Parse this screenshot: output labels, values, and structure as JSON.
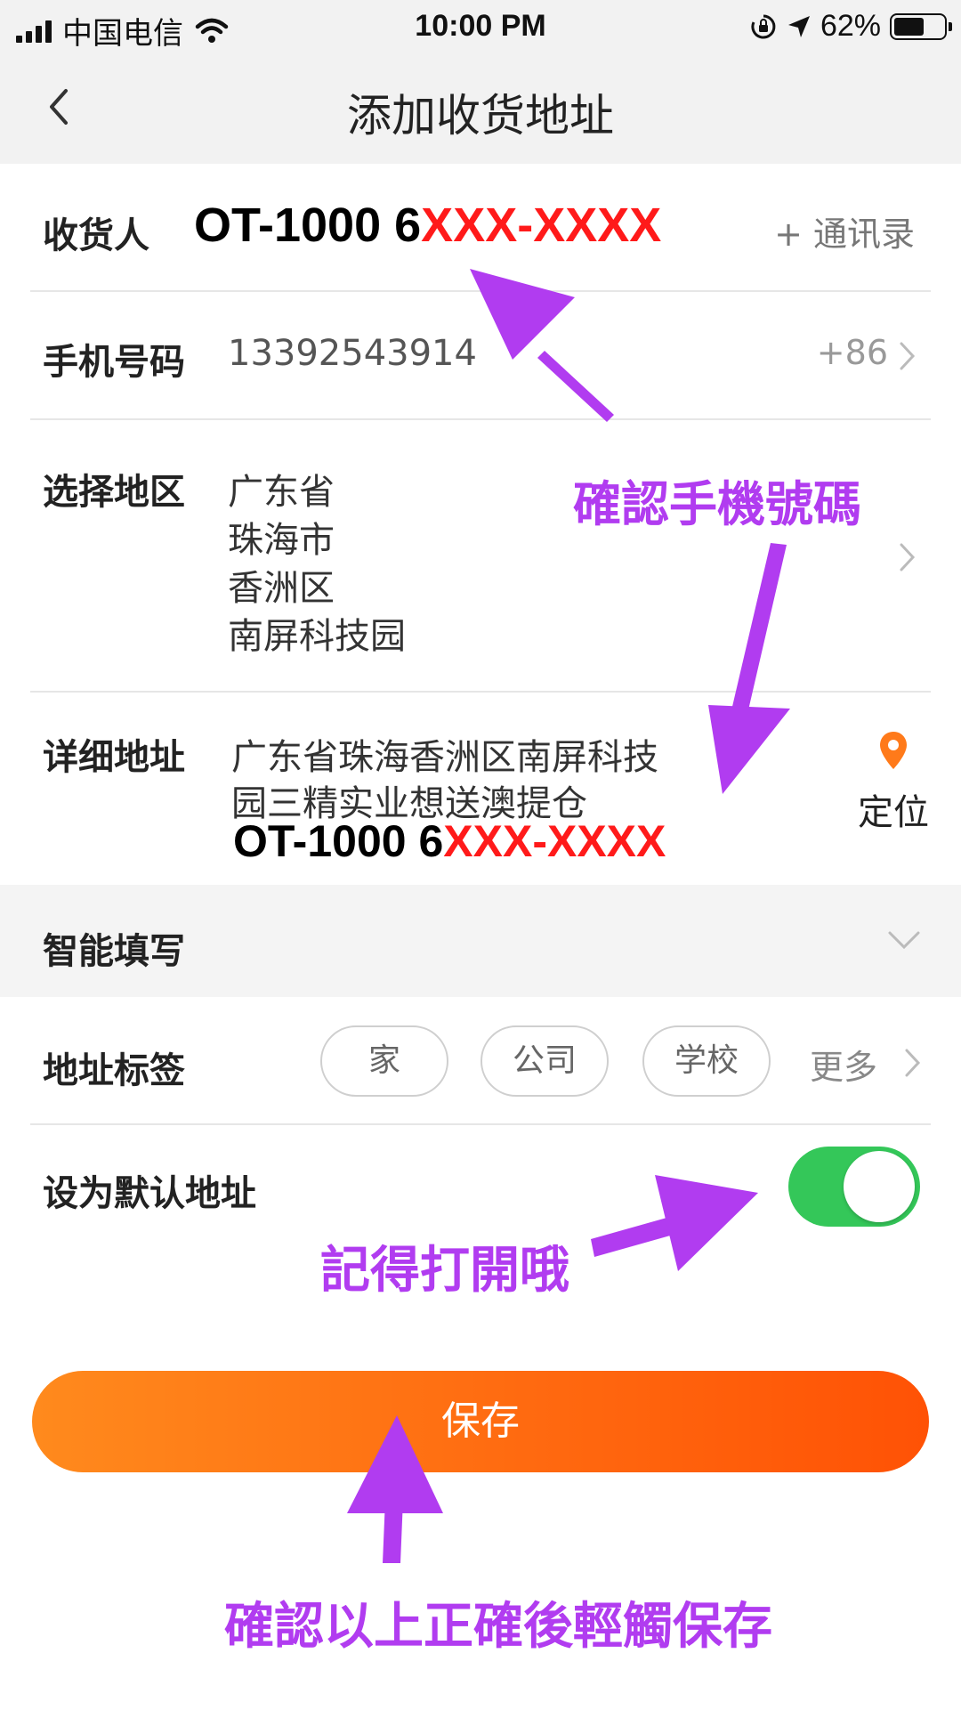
{
  "status_bar": {
    "carrier": "中国电信",
    "time": "10:00 PM",
    "battery_pct": "62%",
    "battery_level": 0.62
  },
  "nav": {
    "title": "添加收货地址",
    "back_icon": "chevron-left-icon"
  },
  "form": {
    "receiver": {
      "label": "收货人",
      "contacts_label": "+ 通讯录",
      "overlay_name": "OT-1000 ",
      "overlay_digit": "6",
      "overlay_mask": "XXX-XXXX"
    },
    "phone": {
      "label": "手机号码",
      "value": "13392543914",
      "country_code": "+86"
    },
    "region": {
      "label": "选择地区",
      "lines": [
        "广东省",
        "珠海市",
        "香洲区",
        "南屏科技园"
      ]
    },
    "address": {
      "label": "详细地址",
      "line1": "广东省珠海香洲区南屏科技",
      "line2": "园三精实业想送澳提仓",
      "overlay_name": "OT-1000 ",
      "overlay_digit": "6",
      "overlay_mask": "XXX-XXXX",
      "locate_label": "定位",
      "locate_icon": "location-pin-icon"
    },
    "smart_fill": {
      "label": "智能填写"
    },
    "tags": {
      "label": "地址标签",
      "items": [
        "家",
        "公司",
        "学校"
      ],
      "more_label": "更多"
    },
    "default": {
      "label": "设为默认地址",
      "enabled": true
    },
    "save_label": "保存"
  },
  "annotations": {
    "confirm_phone": "確認手機號碼",
    "remember_toggle": "記得打開哦",
    "confirm_save": "確認以上正確後輕觸保存"
  },
  "colors": {
    "accent_orange": "#ff6a10",
    "toggle_green": "#34c759",
    "annotation_purple": "#b13cf0",
    "mask_red": "#ff1a1a",
    "pin_orange": "#ff7a1a"
  }
}
